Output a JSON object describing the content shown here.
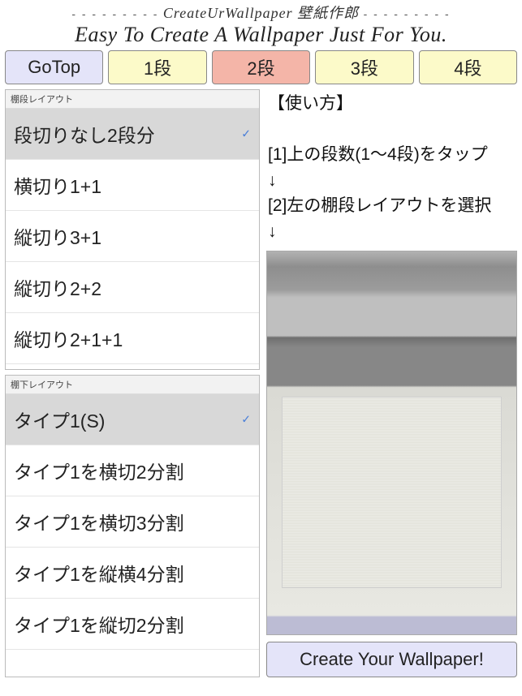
{
  "header": {
    "title_app_en": "CreateUrWallpaper",
    "title_app_jp": "壁紙作郎",
    "subtitle": "Easy To Create A Wallpaper Just For You."
  },
  "tabs": {
    "gotop": "GoTop",
    "items": [
      "1段",
      "2段",
      "3段",
      "4段"
    ],
    "active_index": 1
  },
  "layout_top": {
    "header": "棚段レイアウト",
    "items": [
      "段切りなし2段分",
      "横切り1+1",
      "縦切り3+1",
      "縦切り2+2",
      "縦切り2+1+1"
    ],
    "selected_index": 0
  },
  "layout_bottom": {
    "header": "棚下レイアウト",
    "items": [
      "タイプ1(S)",
      "タイプ1を横切2分割",
      "タイプ1を横切3分割",
      "タイプ1を縦横4分割",
      "タイプ1を縦切2分割"
    ],
    "selected_index": 0
  },
  "instructions": {
    "title": "【使い方】",
    "step1": "[1]上の段数(1〜4段)をタップ",
    "arrow": "↓",
    "step2": "[2]左の棚段レイアウトを選択"
  },
  "create_btn": "Create Your Wallpaper!"
}
